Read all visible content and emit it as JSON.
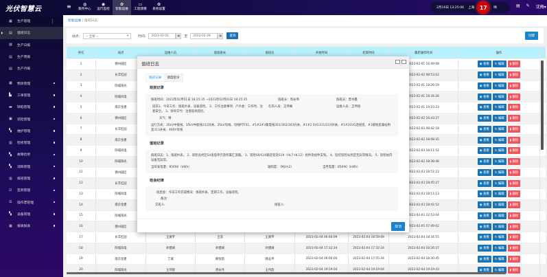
{
  "topbar": {
    "logo": "光伏智慧云",
    "nav": [
      {
        "icon": "globe-icon",
        "label": "服务中心"
      },
      {
        "icon": "location-icon",
        "label": "运行监控"
      },
      {
        "icon": "gear-icon",
        "label": "智能运维",
        "active": true
      },
      {
        "icon": "monitor-icon",
        "label": "工程建模"
      },
      {
        "icon": "gear-icon",
        "label": "系统设置"
      }
    ],
    "datetime": "2月16日 13:25:06",
    "city": "上海",
    "temperature": "17",
    "weather": "晴",
    "user": "沈梅"
  },
  "sidebar": {
    "items": [
      {
        "label": "生产管理",
        "icon": "table-icon",
        "dots": true
      },
      {
        "label": "值班日志",
        "icon": "doc-icon",
        "active": true
      },
      {
        "label": "生产日报",
        "icon": "chart-icon"
      },
      {
        "label": "生产周报",
        "icon": "doc-icon"
      },
      {
        "label": "生产月报",
        "icon": "doc-icon"
      },
      {
        "label": "物资管理",
        "icon": "table-icon"
      },
      {
        "label": "工单管理",
        "icon": "file-icon"
      },
      {
        "label": "缺陷管理",
        "icon": "card-icon"
      },
      {
        "label": "巡检管理",
        "icon": "scan-icon"
      },
      {
        "label": "维护管理",
        "icon": "truck-icon"
      },
      {
        "label": "检修管理",
        "icon": "calendar-icon"
      },
      {
        "label": "故障抢修",
        "icon": "truck-icon"
      },
      {
        "label": "消缺管理",
        "icon": "truck-icon"
      },
      {
        "label": "排班管理",
        "icon": "calendar-icon"
      },
      {
        "label": "签到管理",
        "icon": "check-icon"
      },
      {
        "label": "操作票管理",
        "icon": "ticket-icon"
      },
      {
        "label": "设备管理",
        "icon": "truck-icon"
      },
      {
        "label": "报表报表",
        "icon": "table-icon"
      }
    ]
  },
  "breadcrumb": {
    "parent": "智能运维",
    "current": "值班日志"
  },
  "filter": {
    "station_label": "站点:",
    "station_value": "-- 全部 --",
    "time_label": "时间:",
    "start": "2023-02-01",
    "to": "至",
    "end": "2023-02-28",
    "query": "查询",
    "create": "创建"
  },
  "table": {
    "headers": [
      "序号",
      "站点",
      "运维人员",
      "值班班长",
      "值班员",
      "开始时间",
      "结束时间",
      "最后操作时间",
      "操作"
    ],
    "actions": {
      "view": "查看",
      "edit": "编辑",
      "delete": "删除"
    },
    "rows": [
      [
        "1",
        "德州园区",
        "",
        "",
        "",
        "",
        "",
        "2023-02-01 16:49:08"
      ],
      [
        "2",
        "长丰红园",
        "",
        "",
        "",
        "",
        "",
        "2023-02-02 08:53:02"
      ],
      [
        "3",
        "阳城阳光",
        "",
        "",
        "",
        "",
        "",
        "2023-02-01 18:26:19"
      ],
      [
        "4",
        "阳城风电",
        "",
        "",
        "",
        "",
        "",
        "2023-02-01 18:34:26"
      ],
      [
        "5",
        "南京金建",
        "",
        "",
        "",
        "",
        "",
        "2023-02-01 19:10:23"
      ],
      [
        "6",
        "德州园区",
        "",
        "",
        "",
        "",
        "",
        "2023-02-02 16:43:27"
      ],
      [
        "7",
        "长丰红园",
        "",
        "",
        "",
        "",
        "",
        "2023-02-03 08:42:18"
      ],
      [
        "8",
        "南京金建",
        "",
        "",
        "",
        "",
        "",
        "2023-02-02 18:08:35"
      ],
      [
        "9",
        "阳城风电",
        "",
        "",
        "",
        "",
        "",
        "2023-02-03 18:11:52"
      ],
      [
        "10",
        "阳城阳光",
        "",
        "",
        "",
        "",
        "",
        "2023-02-02 18:38:46"
      ],
      [
        "11",
        "德州园区",
        "",
        "",
        "",
        "",
        "",
        "2023-02-03 18:51:23"
      ],
      [
        "12",
        "长丰红园",
        "",
        "",
        "",
        "",
        "",
        "2023-02-03 18:45:27"
      ],
      [
        "13",
        "阳城风电",
        "",
        "",
        "",
        "",
        "",
        "2023-02-03 18:11:13"
      ],
      [
        "14",
        "南京金建",
        "",
        "",
        "",
        "",
        "",
        "2023-02-03 18:41:52"
      ],
      [
        "15",
        "阳城阳光",
        "",
        "",
        "",
        "",
        "",
        "2023-02-03 22:53:04"
      ],
      [
        "16",
        "德州园区",
        "",
        "",
        "",
        "",
        "",
        "2023-02-05 07:49:02"
      ],
      [
        "17",
        "长丰红园",
        "王寅宇",
        "王浩",
        "王寅宇",
        "2023-02-04 06:00:09",
        "2023-02-04 18:59:09",
        "2023-02-04 18:34:55"
      ],
      [
        "18",
        "阳城风电",
        "孙建阔",
        "孙建阔",
        "孙建阔",
        "2023-02-04 17:32:24",
        "2023-02-04 17:32:24",
        "2023-02-04 18:26:27"
      ],
      [
        "19",
        "南京金建",
        "丁威",
        "韩恒韵",
        "韩志平",
        "2023-02-04 06:00:00",
        "2023-02-04 17:55:34",
        "2023-02-04 18:30:45"
      ],
      [
        "20",
        "阳城阳光",
        "王伟锐",
        "周长伟",
        "王伟韵",
        "2023-02-04 19:19:04",
        "2023-02-04 19:19:04",
        "2023-02-04 19:19:43"
      ]
    ]
  },
  "modal": {
    "title": "值班日志",
    "tabs": [
      "值班记录",
      "调度指令"
    ],
    "pre": {
      "title": "班前记录",
      "duty_time": "值班时间：2023年02月01日 18:25:35 ~2023年02月01日 18:25:35",
      "leader": "值班长：周长伟",
      "staff": "值班员：曾书鑫",
      "meeting": "班前1、今日工作：值班抄表、设备巡检。 2、工作注意事项：户外会：工作时、注意安全。 3、领导交代：注意现场监控。",
      "present": "在岗人员：王伟阁",
      "ops_staff": "运维人员：王伟锐",
      "weather": "天气：晴",
      "mode": "运行方式：35kV中能线、35kV中能线312开关、35kV母线、母线PTP31、#1#2#3集电线301/302/303开关、#1#2 SVG311/314开关、#1#2SVG连接变、#1接地变兼站用变313开关、400V母线"
    },
    "duty": {
      "title": "值班记录",
      "log": "值班日志：1、值班抄表。 2、巡检光伏区S4发电单元及所属汇流箱。 3、巡检S9/S10箱逆变及S19（HL7-HL12）组件及组件支架。 4、监控巡检光伏区无异常情况。 5、巡检站内设备无异常。",
      "daily": "当日发电量：85690（kWh）",
      "irradiance": "辐照度：（MJ/m2）",
      "monthly": "当月电量：85690（kWh）"
    },
    "post": {
      "title": "班会纪律",
      "meeting": "班后会：今日工作完成情况：值班抄表、定期工作、设备巡检。",
      "note": "备注:",
      "handover": "交班人:",
      "receiver": "接班人:"
    },
    "cancel": "取消"
  }
}
